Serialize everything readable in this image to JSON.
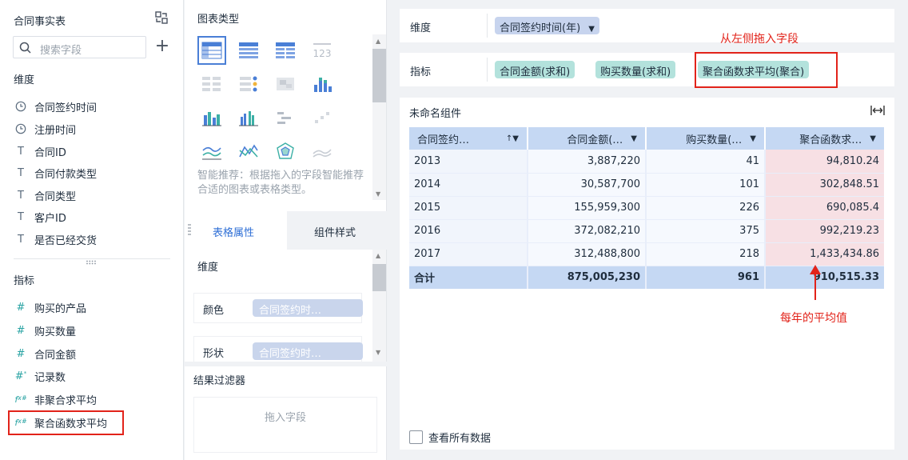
{
  "fields_panel": {
    "title": "合同事实表",
    "search_placeholder": "搜索字段",
    "dimension_header": "维度",
    "dimensions": [
      {
        "icon": "clock-icon",
        "label": "合同签约时间"
      },
      {
        "icon": "clock-icon",
        "label": "注册时间"
      },
      {
        "icon": "text-type-icon",
        "label": "合同ID"
      },
      {
        "icon": "text-type-icon",
        "label": "合同付款类型"
      },
      {
        "icon": "text-type-icon",
        "label": "合同类型"
      },
      {
        "icon": "text-type-icon",
        "label": "客户ID"
      },
      {
        "icon": "text-type-icon",
        "label": "是否已经交货"
      }
    ],
    "measure_header": "指标",
    "measures": [
      {
        "icon": "number-type-icon",
        "label": "购买的产品"
      },
      {
        "icon": "number-type-icon",
        "label": "购买数量"
      },
      {
        "icon": "number-type-icon",
        "label": "合同金额"
      },
      {
        "icon": "count-icon",
        "label": "记录数"
      },
      {
        "icon": "formula-icon",
        "label": "非聚合求平均"
      },
      {
        "icon": "formula-icon",
        "label": "聚合函数求平均"
      }
    ]
  },
  "chart_panel": {
    "title": "图表类型",
    "smart_tip": "智能推荐：根据拖入的字段智能推荐合适的图表或表格类型。",
    "tabs": [
      "表格属性",
      "组件样式"
    ],
    "props": {
      "dimension_label": "维度",
      "color_label": "颜色",
      "color_value": "合同签约时…",
      "shape_label": "形状",
      "shape_value": "合同签约时…"
    },
    "filter": {
      "title": "结果过滤器",
      "drop_hint": "拖入字段"
    }
  },
  "shelves": {
    "dimension_label": "维度",
    "dimension_pill": "合同签约时间(年)",
    "measure_label": "指标",
    "measure_pills": [
      "合同金额(求和)",
      "购买数量(求和)",
      "聚合函数求平均(聚合)"
    ]
  },
  "annotations": {
    "drag_hint": "从左侧拖入字段",
    "avg_hint": "每年的平均值"
  },
  "widget": {
    "title": "未命名组件",
    "columns": [
      "合同签约…",
      "合同金额(…",
      "购买数量(…",
      "聚合函数求…"
    ],
    "rows": [
      [
        "2013",
        "3,887,220",
        "41",
        "94,810.24"
      ],
      [
        "2014",
        "30,587,700",
        "101",
        "302,848.51"
      ],
      [
        "2015",
        "155,959,300",
        "226",
        "690,085.4"
      ],
      [
        "2016",
        "372,082,210",
        "375",
        "992,219.23"
      ],
      [
        "2017",
        "312,488,800",
        "218",
        "1,433,434.86"
      ]
    ],
    "total": [
      "合计",
      "875,005,230",
      "961",
      "910,515.33"
    ],
    "show_all_label": "查看所有数据"
  },
  "colors": {
    "accent": "#2f6fd6",
    "annotation_red": "#e2231a",
    "header_blue": "#c5d8f3",
    "highlight_pink": "#f7e0e4"
  }
}
